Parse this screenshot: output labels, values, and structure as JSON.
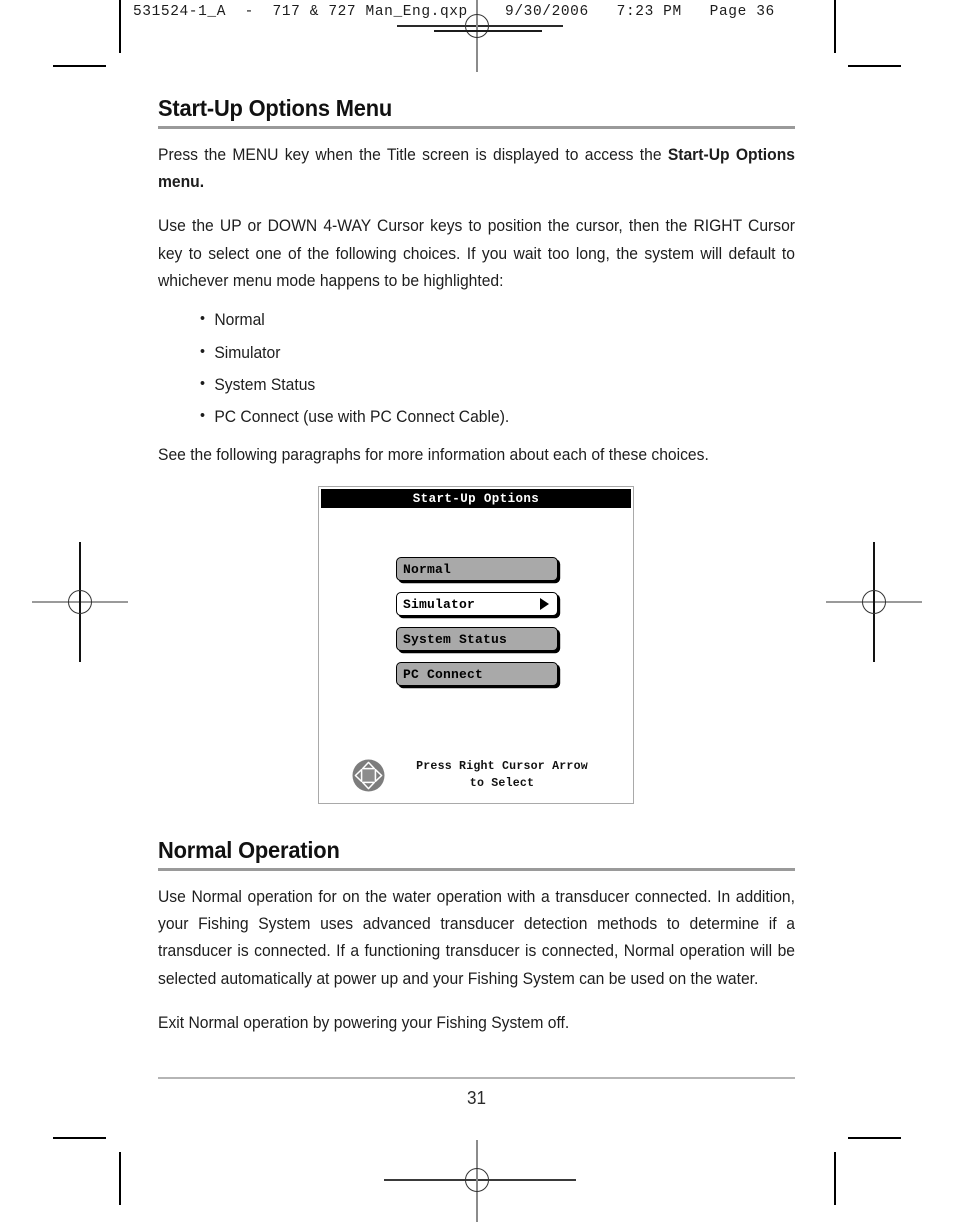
{
  "print_marks": {
    "slug_text": "531524-1_A  -  717 & 727 Man_Eng.qxp    9/30/2006   7:23 PM   Page 36"
  },
  "sections": [
    {
      "heading": "Start-Up Options Menu",
      "paragraphs": [
        {
          "runs": [
            {
              "text": "Press the MENU key when the Title screen is displayed to access the ",
              "bold": false
            },
            {
              "text": "Start-Up Options menu.",
              "bold": true
            }
          ]
        },
        {
          "runs": [
            {
              "text": "Use the UP or  DOWN 4-WAY Cursor keys to position the cursor, then the RIGHT Cursor key to select one of the following choices. If you wait too long, the system will default to whichever menu mode happens to be highlighted:",
              "bold": false
            }
          ]
        }
      ],
      "bullets": [
        "Normal",
        "Simulator",
        "System Status",
        "PC Connect (use with PC Connect Cable)."
      ],
      "closing_paragraph": "See the following paragraphs for more information about each of these choices."
    },
    {
      "heading": "Normal Operation",
      "paragraphs": [
        {
          "runs": [
            {
              "text": "Use Normal operation for on the water operation with a transducer connected. In addition, your Fishing System uses advanced transducer detection methods to determine if a transducer is connected. If a functioning transducer is connected, Normal operation will be selected automatically at power up and your Fishing System can be used on the water.",
              "bold": false
            }
          ]
        },
        {
          "runs": [
            {
              "text": "Exit Normal operation by powering your Fishing System off.",
              "bold": false
            }
          ]
        }
      ]
    }
  ],
  "device_screen": {
    "title": "Start-Up Options",
    "menu_items": [
      {
        "label": "Normal",
        "selected": false,
        "has_arrow": false
      },
      {
        "label": "Simulator",
        "selected": true,
        "has_arrow": true
      },
      {
        "label": "System Status",
        "selected": false,
        "has_arrow": false
      },
      {
        "label": "PC Connect",
        "selected": false,
        "has_arrow": false
      }
    ],
    "footer_line1": "Press Right Cursor Arrow",
    "footer_line2": "to  Select",
    "cursor_icon": "four-way-cursor-pad"
  },
  "footer": {
    "page_number": "31"
  },
  "colors": {
    "menu_fill": "#a9a9a9",
    "menu_selected_fill": "#ffffff",
    "menu_border": "#000000",
    "titlebar_bg": "#000000",
    "titlebar_fg": "#ffffff",
    "rule_gray": "#9a9a9a",
    "footer_rule_gray": "#b5b5b5",
    "cursor_pad_gray": "#7d7d7d"
  }
}
